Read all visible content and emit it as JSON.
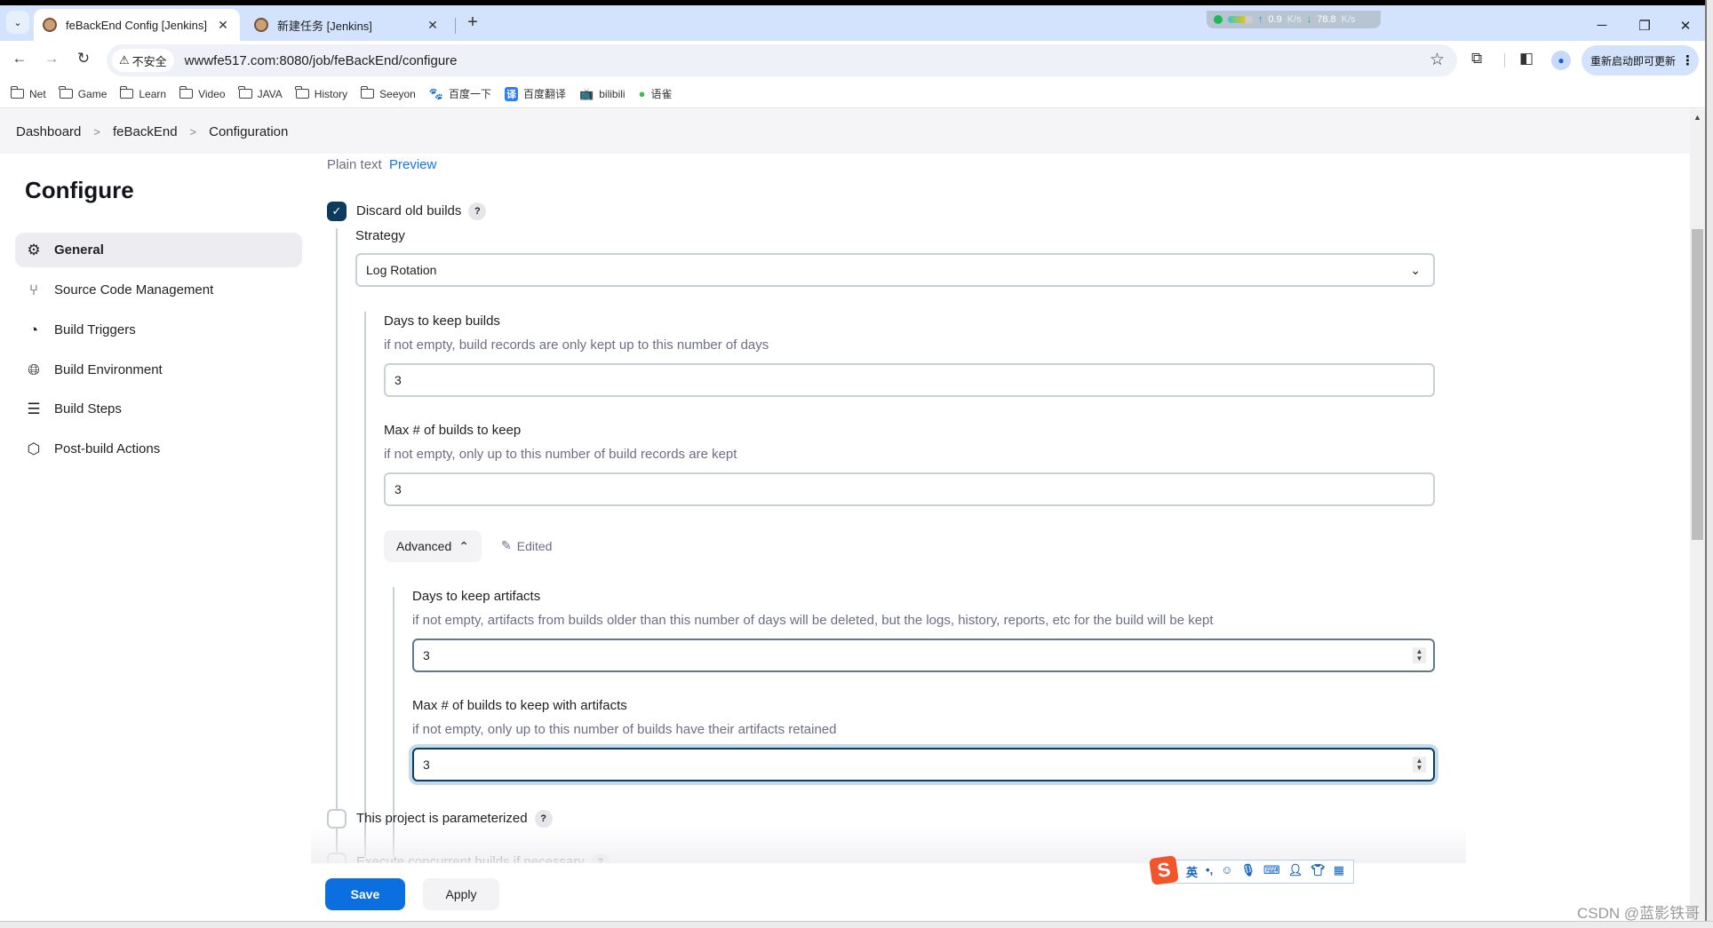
{
  "browser": {
    "tabs": [
      {
        "title": "feBackEnd Config [Jenkins]",
        "active": true
      },
      {
        "title": "新建任务 [Jenkins]",
        "active": false
      }
    ],
    "net_monitor": {
      "up": "0.9",
      "up_unit": "K/s",
      "down": "78.8",
      "down_unit": "K/s"
    },
    "security_label": "不安全",
    "url": "wwwfe517.com:8080/job/feBackEnd/configure",
    "update_label": "重新启动即可更新",
    "bookmarks": [
      {
        "label": "Net",
        "icon": "folder-icon"
      },
      {
        "label": "Game",
        "icon": "folder-icon"
      },
      {
        "label": "Learn",
        "icon": "folder-icon"
      },
      {
        "label": "Video",
        "icon": "folder-icon"
      },
      {
        "label": "JAVA",
        "icon": "folder-icon"
      },
      {
        "label": "History",
        "icon": "folder-icon"
      },
      {
        "label": "Seeyon",
        "icon": "folder-icon"
      },
      {
        "label": "百度一下",
        "icon": "baidu-icon"
      },
      {
        "label": "百度翻译",
        "icon": "translate-icon"
      },
      {
        "label": "bilibili",
        "icon": "bilibili-icon"
      },
      {
        "label": "语雀",
        "icon": "yuque-icon"
      }
    ]
  },
  "breadcrumb": [
    "Dashboard",
    "feBackEnd",
    "Configuration"
  ],
  "sidebar": {
    "title": "Configure",
    "items": [
      {
        "label": "General",
        "icon": "gear-icon",
        "active": true
      },
      {
        "label": "Source Code Management",
        "icon": "branch-icon",
        "active": false
      },
      {
        "label": "Build Triggers",
        "icon": "timer-icon",
        "active": false
      },
      {
        "label": "Build Environment",
        "icon": "globe-icon",
        "active": false
      },
      {
        "label": "Build Steps",
        "icon": "list-icon",
        "active": false
      },
      {
        "label": "Post-build Actions",
        "icon": "package-icon",
        "active": false
      }
    ]
  },
  "main": {
    "description_modes": {
      "plain": "Plain text",
      "preview": "Preview"
    },
    "discard_old_builds": {
      "label": "Discard old builds",
      "checked": true,
      "help": "?"
    },
    "strategy": {
      "label": "Strategy",
      "selected": "Log Rotation"
    },
    "days_to_keep": {
      "label": "Days to keep builds",
      "help": "if not empty, build records are only kept up to this number of days",
      "value": "3"
    },
    "max_builds": {
      "label": "Max # of builds to keep",
      "help": "if not empty, only up to this number of build records are kept",
      "value": "3"
    },
    "advanced": {
      "label": "Advanced",
      "edited": "Edited"
    },
    "artifact_days": {
      "label": "Days to keep artifacts",
      "help": "if not empty, artifacts from builds older than this number of days will be deleted, but the logs, history, reports, etc for the build will be kept",
      "value": "3"
    },
    "artifact_max": {
      "label": "Max # of builds to keep with artifacts",
      "help": "if not empty, only up to this number of builds have their artifacts retained",
      "value": "3"
    },
    "parameterized": {
      "label": "This project is parameterized",
      "checked": false,
      "help": "?"
    },
    "concurrent": {
      "label": "Execute concurrent builds if necessary",
      "checked": false,
      "help": "?"
    }
  },
  "actions": {
    "save": "Save",
    "apply": "Apply"
  },
  "ime": {
    "logo": "S",
    "mode": "英",
    "punct": "•,"
  },
  "watermark": "CSDN @蓝影铁哥"
}
